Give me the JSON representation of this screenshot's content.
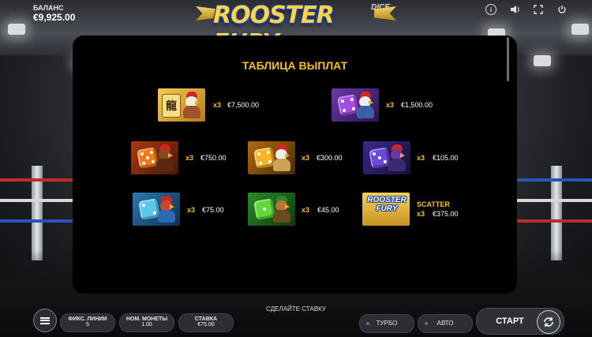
{
  "header": {
    "balance_label": "БАЛАНС",
    "balance_value": "€9,925.00",
    "logo_text": "ROOSTER FURY",
    "logo_sub": "DICE",
    "icons": [
      "info-icon",
      "sound-icon",
      "fullscreen-icon",
      "power-icon"
    ]
  },
  "paytable": {
    "title": "ТАБЛИЦА ВЫПЛАТ",
    "rows": [
      {
        "symbol": "gold-tile-rooster",
        "mult": "x3",
        "amount": "€7,500.00"
      },
      {
        "symbol": "purple-die-rooster",
        "mult": "x3",
        "amount": "€1,500.00"
      },
      {
        "symbol": "orange-die-rooster",
        "mult": "x3",
        "amount": "€750.00"
      },
      {
        "symbol": "yellow-die-rooster",
        "mult": "x3",
        "amount": "€300.00"
      },
      {
        "symbol": "violet-die-rooster",
        "mult": "x3",
        "amount": "€105.00"
      },
      {
        "symbol": "cyan-die-rooster",
        "mult": "x3",
        "amount": "€75.00"
      },
      {
        "symbol": "green-die-rooster",
        "mult": "x3",
        "amount": "€45.00"
      }
    ],
    "scatter": {
      "label": "SCATTER",
      "tile_text": "ROOSTER FURY",
      "mult": "x3",
      "amount": "€375.00"
    }
  },
  "footer": {
    "place_bet": "СДЕЛАЙТЕ СТАВКУ",
    "lines_label": "ФИКС. ЛИНИИ",
    "lines_value": "5",
    "coin_label": "НОМ. МОНЕТЫ",
    "coin_value": "1.00",
    "bet_label": "СТАВКА",
    "bet_value": "€75.00",
    "turbo": "ТУРБО",
    "auto": "АВТО",
    "start": "СТАРТ"
  },
  "colors": {
    "accent": "#f5c21a",
    "panel": "#000000",
    "button": "#2c2e34"
  }
}
